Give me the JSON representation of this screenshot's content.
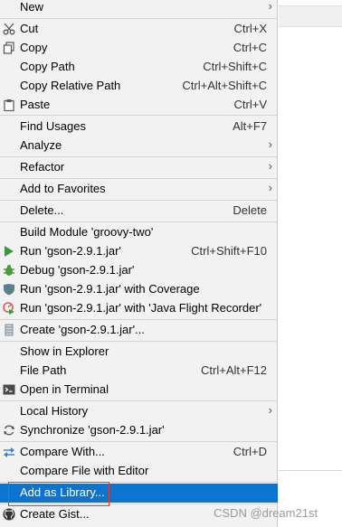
{
  "menu": {
    "items": [
      {
        "label": "New",
        "shortcut": "",
        "submenu": true,
        "icon": ""
      },
      {
        "label": "Cut",
        "shortcut": "Ctrl+X",
        "submenu": false,
        "icon": "scissors-icon"
      },
      {
        "label": "Copy",
        "shortcut": "Ctrl+C",
        "submenu": false,
        "icon": "copy-icon"
      },
      {
        "label": "Copy Path",
        "shortcut": "Ctrl+Shift+C",
        "submenu": false,
        "icon": ""
      },
      {
        "label": "Copy Relative Path",
        "shortcut": "Ctrl+Alt+Shift+C",
        "submenu": false,
        "icon": ""
      },
      {
        "label": "Paste",
        "shortcut": "Ctrl+V",
        "submenu": false,
        "icon": "paste-icon"
      },
      {
        "label": "Find Usages",
        "shortcut": "Alt+F7",
        "submenu": false,
        "icon": ""
      },
      {
        "label": "Analyze",
        "shortcut": "",
        "submenu": true,
        "icon": ""
      },
      {
        "label": "Refactor",
        "shortcut": "",
        "submenu": true,
        "icon": ""
      },
      {
        "label": "Add to Favorites",
        "shortcut": "",
        "submenu": true,
        "icon": ""
      },
      {
        "label": "Delete...",
        "shortcut": "Delete",
        "submenu": false,
        "icon": ""
      },
      {
        "label": "Build Module 'groovy-two'",
        "shortcut": "",
        "submenu": false,
        "icon": ""
      },
      {
        "label": "Run 'gson-2.9.1.jar'",
        "shortcut": "Ctrl+Shift+F10",
        "submenu": false,
        "icon": "run-icon"
      },
      {
        "label": "Debug 'gson-2.9.1.jar'",
        "shortcut": "",
        "submenu": false,
        "icon": "debug-icon"
      },
      {
        "label": "Run 'gson-2.9.1.jar' with Coverage",
        "shortcut": "",
        "submenu": false,
        "icon": "coverage-icon"
      },
      {
        "label": "Run 'gson-2.9.1.jar' with 'Java Flight Recorder'",
        "shortcut": "",
        "submenu": false,
        "icon": "profiler-icon"
      },
      {
        "label": "Create 'gson-2.9.1.jar'...",
        "shortcut": "",
        "submenu": false,
        "icon": "jar-icon"
      },
      {
        "label": "Show in Explorer",
        "shortcut": "",
        "submenu": false,
        "icon": ""
      },
      {
        "label": "File Path",
        "shortcut": "Ctrl+Alt+F12",
        "submenu": false,
        "icon": ""
      },
      {
        "label": "Open in Terminal",
        "shortcut": "",
        "submenu": false,
        "icon": "terminal-icon"
      },
      {
        "label": "Local History",
        "shortcut": "",
        "submenu": true,
        "icon": ""
      },
      {
        "label": "Synchronize 'gson-2.9.1.jar'",
        "shortcut": "",
        "submenu": false,
        "icon": "sync-icon"
      },
      {
        "label": "Compare With...",
        "shortcut": "Ctrl+D",
        "submenu": false,
        "icon": "compare-icon"
      },
      {
        "label": "Compare File with Editor",
        "shortcut": "",
        "submenu": false,
        "icon": ""
      },
      {
        "label": "Add as Library...",
        "shortcut": "",
        "submenu": false,
        "icon": ""
      },
      {
        "label": "Create Gist...",
        "shortcut": "",
        "submenu": false,
        "icon": "github-icon"
      }
    ],
    "selected_index": 24,
    "submenu_arrow": "›"
  },
  "watermark": "CSDN @dream21st",
  "colors": {
    "selection": "#0b74ce",
    "highlight_box": "#e53935",
    "menu_bg": "#f2f2f2"
  }
}
